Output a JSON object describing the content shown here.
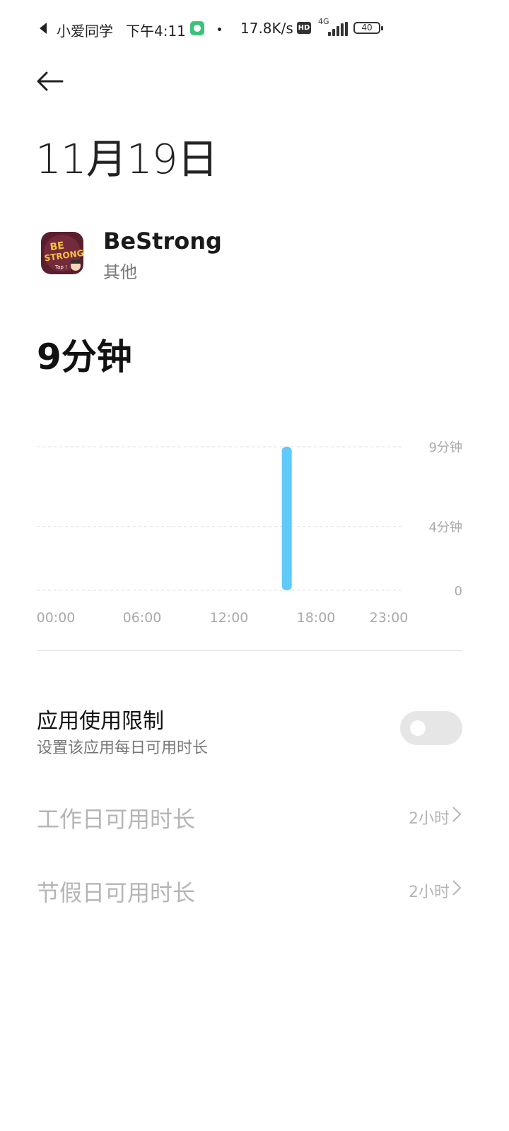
{
  "status_bar": {
    "carrier": "小爱同学",
    "time": "下午4:11",
    "speed": "17.8K/s",
    "hd": "HD",
    "network": "4G",
    "battery": "40"
  },
  "header": {
    "date": "11月19日"
  },
  "app": {
    "name": "BeStrong",
    "category": "其他",
    "icon": "bestrong-app-icon"
  },
  "usage": {
    "total": "9分钟"
  },
  "chart_data": {
    "type": "bar",
    "x_ticks": [
      "00:00",
      "06:00",
      "12:00",
      "18:00",
      "23:00"
    ],
    "y_ticks": [
      "9分钟",
      "4分钟",
      "0"
    ],
    "ylim": [
      0,
      9
    ],
    "bars": [
      {
        "hour": 16,
        "minutes": 9
      }
    ],
    "color": "#5ecbfb",
    "grid": true
  },
  "limit": {
    "title": "应用使用限制",
    "description": "设置该应用每日可用时长",
    "enabled": false
  },
  "rows": [
    {
      "label": "工作日可用时长",
      "value": "2小时"
    },
    {
      "label": "节假日可用时长",
      "value": "2小时"
    }
  ]
}
